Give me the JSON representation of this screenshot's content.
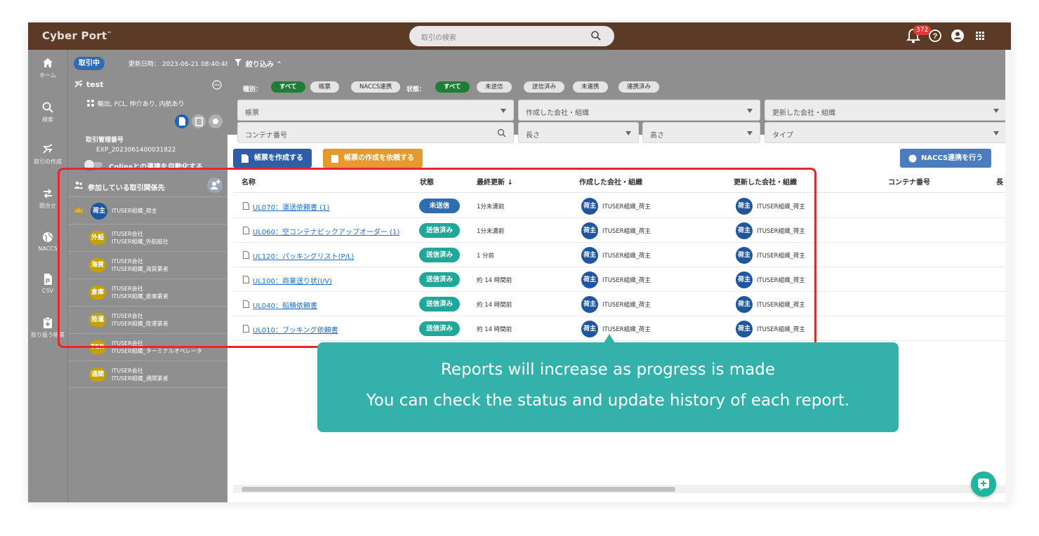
{
  "app": {
    "logo": "Cyber Port",
    "logo_mark": "™"
  },
  "search": {
    "placeholder": "取引の検索"
  },
  "notifications": {
    "count": "372"
  },
  "nav": [
    {
      "label": "ホーム",
      "icon": "home-icon"
    },
    {
      "label": "検索",
      "icon": "search-icon"
    },
    {
      "label": "取引の作成",
      "icon": "deal-create-icon"
    },
    {
      "label": "照合せ",
      "icon": "swap-icon"
    },
    {
      "label": "NACCS",
      "icon": "globe-icon"
    },
    {
      "label": "CSV",
      "icon": "csv-file-icon"
    },
    {
      "label": "取り扱う帳票",
      "icon": "clipboard-add-icon"
    }
  ],
  "deal": {
    "status": "取引中",
    "updated": "更新日時： 2023-06-21 08:40:48",
    "name": "test",
    "tags": "輸出, FCL, 仲介あり, 内航あり",
    "mgmt_label": "取引管理番号",
    "mgmt_value": "EXP_2023061400031822",
    "toggle_label": "Colinsとの連携を自動化する",
    "toggle_on": false,
    "parties_label": "参加している取引関係先"
  },
  "parties": [
    {
      "badge": "荷主",
      "org": "ITUSER組織_荷主",
      "owner": true
    },
    {
      "badge": "外船",
      "company": "ITUSER会社",
      "org": "ITUSER組織_外航船社"
    },
    {
      "badge": "海貨",
      "company": "ITUSER会社",
      "org": "ITUSER組織_海貨業者"
    },
    {
      "badge": "倉庫",
      "company": "ITUSER会社",
      "org": "ITUSER組織_倉庫業者"
    },
    {
      "badge": "陸運",
      "company": "ITUSER会社",
      "org": "ITUSER組織_陸運業者"
    },
    {
      "badge": "TER",
      "company": "ITUSER会社",
      "org": "ITUSER組織_ターミナルオペレータ"
    },
    {
      "badge": "通関",
      "company": "ITUSER会社",
      "org": "ITUSER組織_通関業者"
    }
  ],
  "filter": {
    "title": "絞り込み",
    "type_label": "種別：",
    "type_chips": [
      "すべて",
      "帳票",
      "NACCS連携"
    ],
    "status_label": "状態：",
    "status_chips": [
      "すべて",
      "未送信",
      "送信済み",
      "未連携",
      "連携済み"
    ],
    "fields": {
      "doc": "帳票",
      "created_org": "作成した会社・組織",
      "updated_org": "更新した会社・組織",
      "container": "コンテナ番号",
      "length": "長さ",
      "height": "高さ",
      "type": "タイプ"
    }
  },
  "actions": {
    "create": "帳票を作成する",
    "request": "帳票の作成を依頼する",
    "naccs": "NACCS連携を行う"
  },
  "table": {
    "headers": [
      "名称",
      "状態",
      "最終更新",
      "作成した会社・組織",
      "更新した会社・組織",
      "コンテナ番号",
      "長"
    ],
    "rows": [
      {
        "name": "UL070：運送依頼書 (1)",
        "status": "未送信",
        "updated": "1分未満前",
        "creator_badge": "荷主",
        "creator": "ITUSER組織_荷主",
        "updater_badge": "荷主",
        "updater": "ITUSER組織_荷主"
      },
      {
        "name": "UL060：空コンテナピックアップオーダー (1)",
        "status": "送信済み",
        "updated": "1分未満前",
        "creator_badge": "荷主",
        "creator": "ITUSER組織_荷主",
        "updater_badge": "荷主",
        "updater": "ITUSER組織_荷主"
      },
      {
        "name": "UL120：パッキングリスト(P/L)",
        "status": "送信済み",
        "updated": "1 分前",
        "creator_badge": "荷主",
        "creator": "ITUSER組織_荷主",
        "updater_badge": "荷主",
        "updater": "ITUSER組織_荷主"
      },
      {
        "name": "UL100：商業送り状(I/V)",
        "status": "送信済み",
        "updated": "約 14 時間前",
        "creator_badge": "荷主",
        "creator": "ITUSER組織_荷主",
        "updater_badge": "荷主",
        "updater": "ITUSER組織_荷主"
      },
      {
        "name": "UL040：船積依頼書",
        "status": "送信済み",
        "updated": "約 14 時間前",
        "creator_badge": "荷主",
        "creator": "ITUSER組織_荷主",
        "updater_badge": "荷主",
        "updater": "ITUSER組織_荷主"
      },
      {
        "name": "UL010：ブッキング依頼書",
        "status": "送信済み",
        "updated": "約 14 時間前",
        "creator_badge": "荷主",
        "creator": "ITUSER組織_荷主",
        "updater_badge": "荷主",
        "updater": "ITUSER組織_荷主"
      }
    ]
  },
  "tooltip": {
    "line1": "Reports will increase as progress is made",
    "line2": "You can check the status and update history of each report."
  },
  "colors": {
    "topbar": "#5b3a26",
    "sidebar_dim": "#8f8f8f",
    "status_unsent": "#2f6db3",
    "status_sent": "#1fa89a",
    "chip_active": "#1e7e34",
    "btn_create": "#2f5da8",
    "btn_request": "#e69a2e",
    "btn_naccs": "#4a7cbf",
    "highlight": "#e8262a",
    "tooltip": "#35b1ab"
  }
}
